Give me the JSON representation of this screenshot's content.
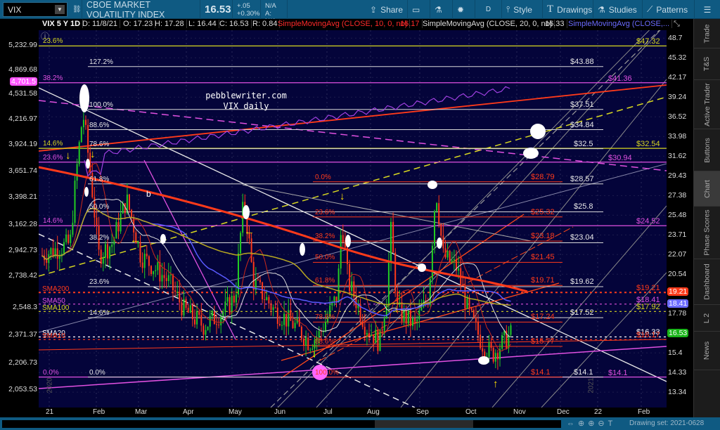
{
  "toolbar": {
    "symbol": "VIX",
    "description": "CBOE MARKET VOLATILITY INDEX",
    "last": "16.53",
    "change": "+.05",
    "change_pct": "+0.30%",
    "bid": "B: N/A",
    "ask": "A: N/A",
    "buttons": {
      "share": "Share",
      "period": "D",
      "style": "Style",
      "drawings": "Drawings",
      "studies": "Studies",
      "patterns": "Patterns"
    }
  },
  "infobar": {
    "title": "VIX 5 Y 1D",
    "date": "D: 11/8/21",
    "open": "O: 17.23",
    "high": "H: 17.28",
    "low": "L: 16.44",
    "close": "C: 16.53",
    "range": "R: 0.84",
    "sma10_label": "SimpleMovingAvg (CLOSE, 10, 0, no)",
    "sma10_value": "16.17",
    "sma20_label": "SimpleMovingAvg (CLOSE, 20, 0, no)",
    "sma20_value": "16.33",
    "sma50_label": "SimpleMovingAvg (CLOSE,..."
  },
  "left_axis": [
    "5,232.99",
    "4,869.68",
    "4,531.58",
    "4,216.97",
    "3,924.19",
    "3,651.74",
    "3,398.21",
    "3,162.28",
    "2,942.73",
    "2,738.42",
    "2,548.3",
    "2,371.37",
    "2,206.73",
    "2,053.53"
  ],
  "left_badge": "4,701.5",
  "right_axis": [
    "48.7",
    "45.32",
    "42.17",
    "39.24",
    "36.52",
    "33.98",
    "31.62",
    "29.43",
    "27.38",
    "25.48",
    "23.71",
    "22.07",
    "20.54",
    "17.78",
    "15.4",
    "14.33",
    "13.34"
  ],
  "right_badges": [
    {
      "value": "19.21",
      "color": "#ff3a1a"
    },
    {
      "value": "18.41",
      "color": "#6b6bff"
    },
    {
      "value": "16.53",
      "color": "#19b319"
    }
  ],
  "x_axis": [
    "21",
    "Feb",
    "Mar",
    "Apr",
    "May",
    "Jun",
    "Jul",
    "Aug",
    "Sep",
    "Oct",
    "Nov",
    "Dec",
    "22",
    "Feb"
  ],
  "watermark": {
    "line1": "pebblewriter.com",
    "line2": "VIX daily"
  },
  "colors": {
    "white_fib": "#d8d8d8",
    "red_fib": "#ff3a1a",
    "magenta": "#e050e0",
    "yellow": "#d8d820",
    "bg": "#04043a"
  },
  "white_fib": [
    {
      "pct": "127.2%",
      "price": "$43.88",
      "v": 43.88
    },
    {
      "pct": "100.0%",
      "price": "$37.51",
      "v": 37.51
    },
    {
      "pct": "88.6%",
      "price": "$34.84",
      "v": 34.84
    },
    {
      "pct": "78.6%",
      "price": "$32.5",
      "v": 32.5
    },
    {
      "pct": "61.8%",
      "price": "$28.57",
      "v": 28.57
    },
    {
      "pct": "50.0%",
      "price": "$25.8",
      "v": 25.8
    },
    {
      "pct": "38.2%",
      "price": "$23.04",
      "v": 23.04
    },
    {
      "pct": "23.6%",
      "price": "$19.62",
      "v": 19.62
    },
    {
      "pct": "14.6%",
      "price": "$17.52",
      "v": 17.52
    },
    {
      "pct": "0.0%",
      "price": "$14.1",
      "v": 14.1
    }
  ],
  "red_fib": [
    {
      "pct": "0.0%",
      "price": "$28.79",
      "v": 28.79
    },
    {
      "pct": "23.6%",
      "price": "$25.32",
      "v": 25.32
    },
    {
      "pct": "38.2%",
      "price": "$23.18",
      "v": 23.18
    },
    {
      "pct": "50.0%",
      "price": "$21.45",
      "v": 21.45
    },
    {
      "pct": "61.8%",
      "price": "$19.71",
      "v": 19.71
    },
    {
      "pct": "78.6%",
      "price": "$17.24",
      "v": 17.24
    },
    {
      "pct": "88.6%",
      "price": "$15.77",
      "v": 15.77
    },
    {
      "pct": "100.0%",
      "price": "$14.1",
      "v": 14.1
    }
  ],
  "left_fib": [
    {
      "pct": "23.6%",
      "price": "$47.32",
      "v": 47.32,
      "color": "#d8d820"
    },
    {
      "pct": "38.2%",
      "price": "$41.36",
      "v": 41.36,
      "color": "#e050e0"
    },
    {
      "pct": "14.6%",
      "price": "$32.54",
      "v": 32.54,
      "color": "#d8d820"
    },
    {
      "pct": "23.6%",
      "price": "$30.94",
      "v": 30.94,
      "color": "#e050e0"
    },
    {
      "pct": "14.6%",
      "price": "$24.52",
      "v": 24.52,
      "color": "#e050e0"
    },
    {
      "pct": "0.0%",
      "price": "$14.1",
      "v": 14.1,
      "color": "#e050e0"
    }
  ],
  "sma": [
    {
      "name": "SMA200",
      "price": "$19.21",
      "v": 19.21,
      "color": "#ff3a1a"
    },
    {
      "name": "SMA50",
      "price": "$18.41",
      "v": 18.41,
      "color": "#e050e0"
    },
    {
      "name": "SMA100",
      "price": "$17.92",
      "v": 17.92,
      "color": "#d8d820"
    },
    {
      "name": "SMA20",
      "price": "$16.33",
      "v": 16.33,
      "color": "#ffffff"
    },
    {
      "name": "SMA10",
      "price": "$16.17",
      "v": 16.17,
      "color": "#ff3a1a"
    }
  ],
  "annotation_b": "b",
  "year_labels": [
    "2020",
    "2021"
  ],
  "sidebar": [
    "Trade",
    "T&S",
    "Active Trader",
    "Buttons",
    "Chart",
    "Phase Scores",
    "Dashboard",
    "L 2",
    "News"
  ],
  "drawing_set": "Drawing set: 2021-0628"
}
